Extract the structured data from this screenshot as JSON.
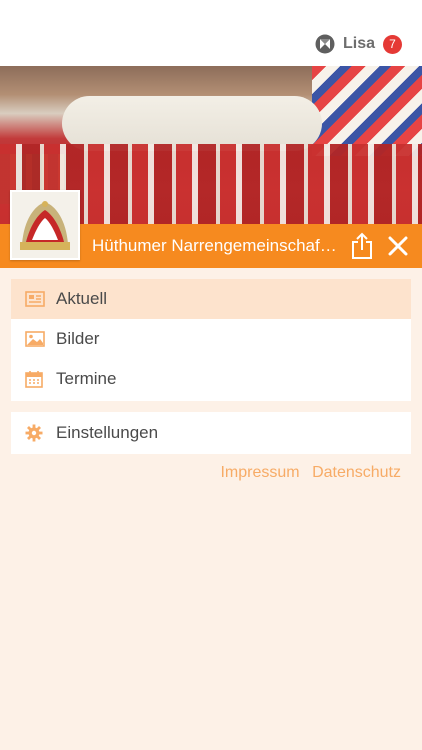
{
  "header": {
    "user_name": "Lisa",
    "notification_count": "7",
    "user_logo_icon": "app-logo-icon"
  },
  "club": {
    "name": "Hüthumer Narrengemeinschaf…",
    "share_icon": "share-icon",
    "close_icon": "close-icon"
  },
  "menu": {
    "primary": [
      {
        "label": "Aktuell",
        "icon": "news-icon",
        "active": true
      },
      {
        "label": "Bilder",
        "icon": "image-icon",
        "active": false
      },
      {
        "label": "Termine",
        "icon": "calendar-icon",
        "active": false
      }
    ],
    "secondary": [
      {
        "label": "Einstellungen",
        "icon": "gear-icon",
        "active": false
      }
    ]
  },
  "footer": {
    "impressum": "Impressum",
    "datenschutz": "Datenschutz"
  },
  "colors": {
    "accent": "#f68a1f",
    "badge": "#e53935",
    "background": "#fdf1e7",
    "active_item": "#fde3cd",
    "icon": "#f7ab66"
  }
}
